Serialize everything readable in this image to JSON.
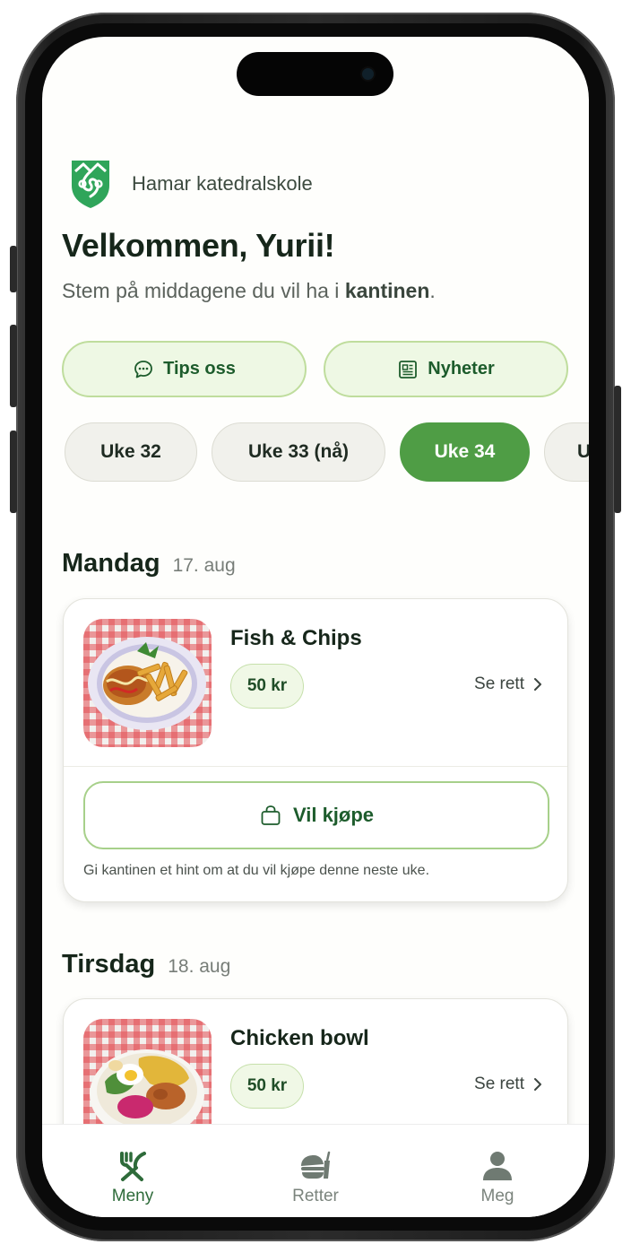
{
  "school": {
    "name": "Hamar katedralskole"
  },
  "header": {
    "welcome": "Velkommen, Yurii!",
    "subtitle_prefix": "Stem på middagene du vil ha i ",
    "subtitle_bold": "kantinen",
    "subtitle_suffix": "."
  },
  "actions": [
    {
      "label": "Tips oss",
      "icon": "chat-bubble-icon"
    },
    {
      "label": "Nyheter",
      "icon": "newspaper-icon"
    }
  ],
  "weeks": [
    {
      "label": "Uke 32",
      "active": false
    },
    {
      "label": "Uke 33 (nå)",
      "active": false
    },
    {
      "label": "Uke 34",
      "active": true
    },
    {
      "label": "U",
      "active": false
    }
  ],
  "days": [
    {
      "name": "Mandag",
      "date": "17. aug",
      "dish": {
        "name": "Fish & Chips",
        "price": "50 kr",
        "see_label": "Se rett",
        "buy_label": "Vil kjøpe",
        "hint": "Gi kantinen et hint om at du vil kjøpe denne neste uke."
      }
    },
    {
      "name": "Tirsdag",
      "date": "18. aug",
      "dish": {
        "name": "Chicken bowl",
        "price": "50 kr",
        "see_label": "Se rett"
      }
    }
  ],
  "tabs": [
    {
      "label": "Meny",
      "icon": "fork-knife-icon",
      "active": true
    },
    {
      "label": "Retter",
      "icon": "meal-icon",
      "active": false
    },
    {
      "label": "Meg",
      "icon": "person-icon",
      "active": false
    }
  ],
  "colors": {
    "accent": "#4f9d45",
    "dark_green": "#1d5c2c",
    "light_green": "#eef8e4",
    "chip_bg": "#f1f1ec"
  }
}
